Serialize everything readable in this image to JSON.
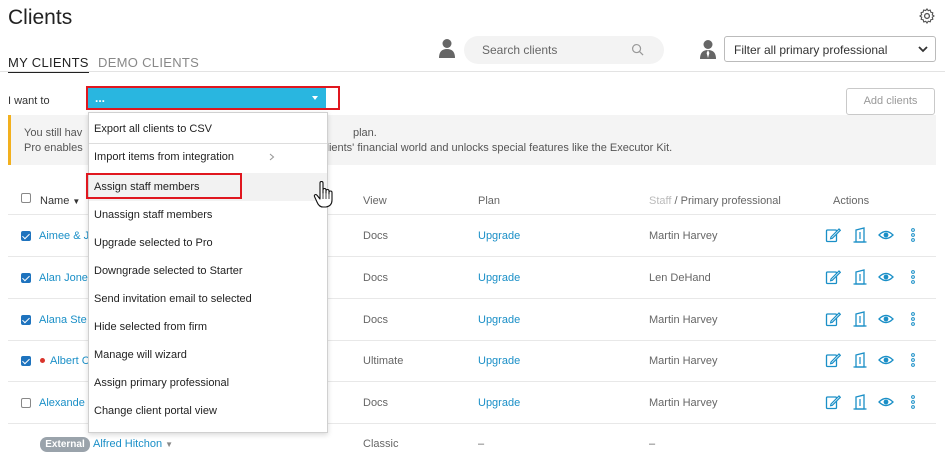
{
  "header": {
    "title": "Clients"
  },
  "tabs": [
    {
      "label": "MY CLIENTS",
      "active": true
    },
    {
      "label": "DEMO CLIENTS",
      "active": false
    }
  ],
  "search": {
    "placeholder": "Search clients",
    "value": ""
  },
  "filter": {
    "selected": "Filter all primary professional"
  },
  "toolbar": {
    "i_want_label": "I want to",
    "action_selected": "...",
    "add_clients_label": "Add clients"
  },
  "notice": {
    "line1_start": "You still hav",
    "line1_end": "plan.",
    "line2_start": "Pro enables",
    "line2_end": "clients' financial world and unlocks special features like the Executor Kit."
  },
  "table": {
    "headers": {
      "name": "Name",
      "view": "View",
      "plan": "Plan",
      "staff": "Staff",
      "staff_sep": " / ",
      "primary": "Primary professional",
      "actions": "Actions"
    },
    "rows": [
      {
        "name": "Aimee & J",
        "view": "Docs",
        "plan": "Upgrade",
        "professional": "Martin Harvey",
        "checked": true
      },
      {
        "name": "Alan Jone",
        "view": "Docs",
        "plan": "Upgrade",
        "professional": "Len DeHand",
        "checked": true
      },
      {
        "name": "Alana Ste",
        "view": "Docs",
        "plan": "Upgrade",
        "professional": "Martin Harvey",
        "checked": true
      },
      {
        "name": "Albert C",
        "view": "Ultimate",
        "plan": "Upgrade",
        "professional": "Martin Harvey",
        "checked": true
      },
      {
        "name": "Alexande",
        "view": "Docs",
        "plan": "Upgrade",
        "professional": "Martin Harvey",
        "checked": false
      },
      {
        "name": "Alfred Hitchon",
        "view": "Classic",
        "plan": "–",
        "professional": "–",
        "badge": "External"
      }
    ]
  },
  "dropdown": {
    "items": [
      {
        "label": "Export all clients to CSV"
      },
      {
        "label": "Import items from integration",
        "submenu": true
      },
      {
        "label": "Assign staff members",
        "hover": true
      },
      {
        "label": "Unassign staff members"
      },
      {
        "label": "Upgrade selected to Pro"
      },
      {
        "label": "Downgrade selected to Starter"
      },
      {
        "label": "Send invitation email to selected"
      },
      {
        "label": "Hide selected from firm"
      },
      {
        "label": "Manage will wizard"
      },
      {
        "label": "Assign primary professional"
      },
      {
        "label": "Change client portal view"
      }
    ]
  },
  "colors": {
    "accent": "#29b6e0",
    "link": "#1a8fc7",
    "highlight_border": "#e0171f",
    "notice_border": "#f2b01e",
    "checkbox": "#1e73be"
  }
}
